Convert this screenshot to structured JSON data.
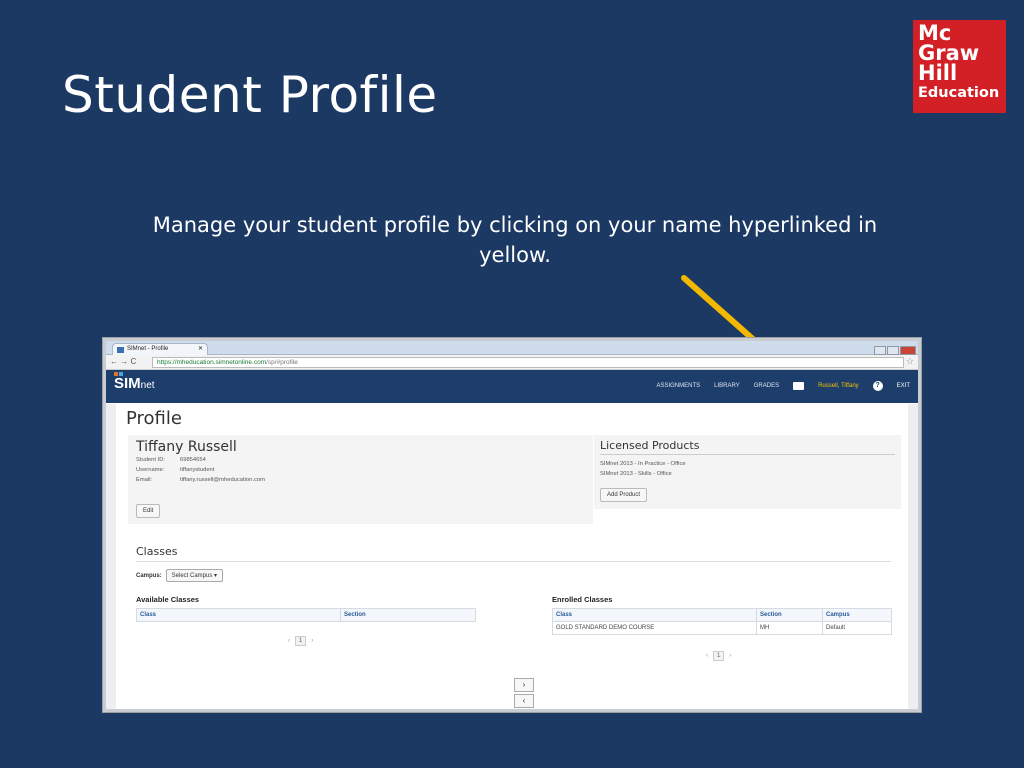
{
  "slide": {
    "title": "Student Profile",
    "caption": "Manage your student profile by clicking on your name hyperlinked in yellow.",
    "logo": [
      "Mc",
      "Graw",
      "Hill",
      "Education"
    ],
    "arrow_color": "#f5b800",
    "logo_color": "#d31f26",
    "background": "#1b3963"
  },
  "browser": {
    "tab_title": "SIMnet - Profile",
    "url_host": "https://mheducation.simnetonline.com",
    "url_path": "/sp/#profile"
  },
  "app": {
    "brand": "SIM",
    "brand_suffix": "net",
    "nav": [
      "ASSIGNMENTS",
      "LIBRARY",
      "GRADES"
    ],
    "user_link": "Russell, Tiffany",
    "exit_label": "EXIT"
  },
  "profile": {
    "page_title": "Profile",
    "name": "Tiffany Russell",
    "fields": [
      {
        "label": "Student ID:",
        "value": "69854654"
      },
      {
        "label": "Username:",
        "value": "tiffanystudent"
      },
      {
        "label": "Email:",
        "value": "tiffany.russell@mheducation.com"
      }
    ],
    "edit_label": "Edit"
  },
  "licensed": {
    "title": "Licensed Products",
    "products": [
      "SIMnet 2013 - In Practice - Office",
      "SIMnet 2013 - Skills - Office"
    ],
    "add_label": "Add Product"
  },
  "classes": {
    "title": "Classes",
    "campus_label": "Campus:",
    "campus_select": "Select Campus",
    "available": {
      "title": "Available Classes",
      "headers": [
        "Class",
        "Section"
      ]
    },
    "enrolled": {
      "title": "Enrolled Classes",
      "headers": [
        "Class",
        "Section",
        "Campus"
      ],
      "rows": [
        [
          "GOLD STANDARD DEMO COURSE",
          "MH",
          "Default"
        ]
      ]
    },
    "page_number": "1"
  }
}
